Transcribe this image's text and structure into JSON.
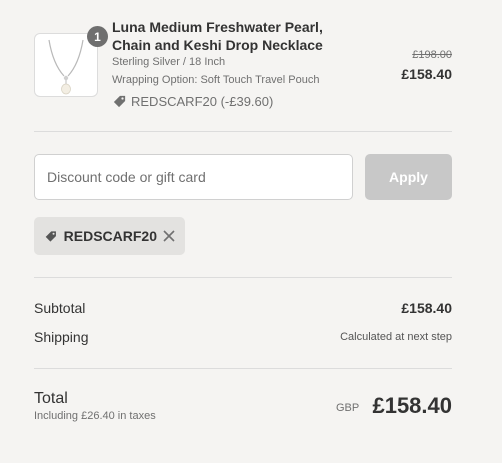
{
  "product": {
    "quantity": "1",
    "name": "Luna Medium Freshwater Pearl, Chain and Keshi Drop Necklace",
    "variant": "Sterling Silver / 18 Inch",
    "wrapping": "Wrapping Option: Soft Touch Travel Pouch",
    "discount": "REDSCARF20 (-£39.60)",
    "original_price": "£198.00",
    "price": "£158.40"
  },
  "discount_form": {
    "placeholder": "Discount code or gift card",
    "value": "",
    "apply_label": "Apply"
  },
  "applied_code": {
    "code": "REDSCARF20"
  },
  "summary": {
    "subtotal_label": "Subtotal",
    "subtotal_value": "£158.40",
    "shipping_label": "Shipping",
    "shipping_value": "Calculated at next step"
  },
  "total": {
    "label": "Total",
    "tax_note": "Including £26.40 in taxes",
    "currency": "GBP",
    "amount": "£158.40"
  },
  "colors": {
    "background": "#f5f4f2",
    "apply_disabled": "#c8c8c8",
    "chip_bg": "#e3e2e0",
    "badge": "#6f6f6f"
  },
  "icons": [
    "necklace-image",
    "tag-icon",
    "close-icon"
  ]
}
